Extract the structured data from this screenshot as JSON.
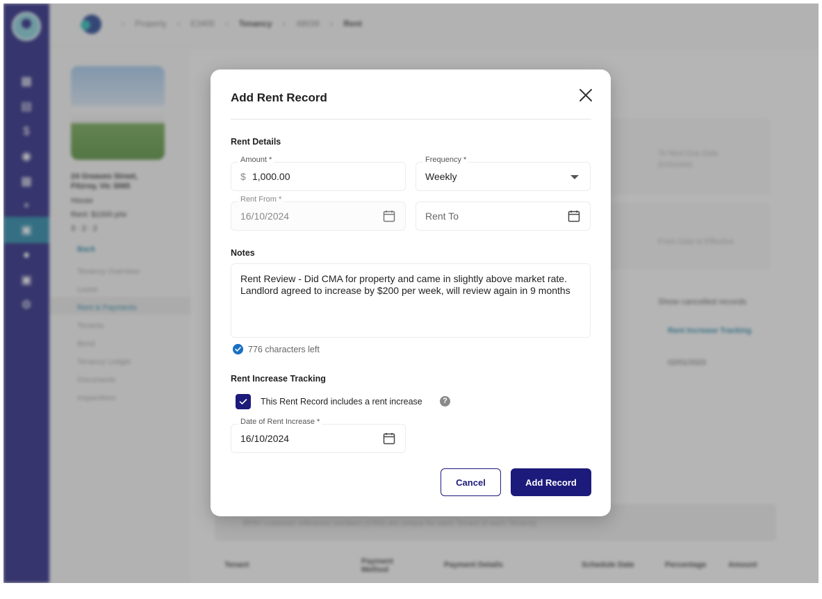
{
  "background": {
    "breadcrumbs": [
      "Property",
      "E3405",
      "Tenancy",
      "48039",
      "Rent"
    ],
    "property": {
      "address_line1": "24 Greaves Street,",
      "address_line2": "Fitzroy, Vic 3065",
      "type": "House",
      "rent": "Rent: $1000 p/w",
      "features": "3 · 2 · 2",
      "back_label": "Back"
    },
    "nav": [
      "Tenancy Overview",
      "Lease",
      "Rent & Payments",
      "Tenants",
      "Bond",
      "Tenancy Ledger",
      "Documents",
      "Inspections"
    ],
    "main": {
      "next_due_label": "To Next Due Date",
      "next_due_sub": "(inclusive)",
      "from_date_label": "From Date to Effective",
      "show_cancelled": "Show cancelled records",
      "rent_tracking": "Rent Increase Tracking",
      "row_date": "02/01/2023",
      "bpay_note": "BPAY customer reference numbers (CRN) are unique for each Tenant of each Tenancy",
      "table_headers": [
        "Tenant",
        "Payment Method",
        "Payment Details",
        "Schedule Date",
        "Percentage",
        "Amount"
      ]
    }
  },
  "modal": {
    "title": "Add Rent Record",
    "rent_details_title": "Rent Details",
    "amount": {
      "label": "Amount *",
      "currency": "$",
      "value": "1,000.00"
    },
    "frequency": {
      "label": "Frequency *",
      "value": "Weekly"
    },
    "rent_from": {
      "label": "Rent From *",
      "value": "16/10/2024"
    },
    "rent_to": {
      "placeholder": "Rent To"
    },
    "notes_title": "Notes",
    "notes_value": "Rent Review - Did CMA for property and came in slightly above market rate. Landlord agreed to increase by $200 per week, will review again in 9 months",
    "chars_left": "776 characters left",
    "tracking_title": "Rent Increase Tracking",
    "includes_increase_label": "This Rent Record includes a rent increase",
    "includes_increase_checked": true,
    "date_of_increase": {
      "label": "Date of Rent Increase *",
      "value": "16/10/2024"
    },
    "cancel_label": "Cancel",
    "add_label": "Add Record"
  },
  "colors": {
    "brand_navy": "#1c1a7a",
    "accent_teal": "#1b7ea1",
    "info_blue": "#1a6fc4"
  },
  "icons": [
    "close-icon",
    "calendar-icon",
    "chevron-down-icon",
    "check-icon",
    "help-icon",
    "check-circle-icon"
  ]
}
